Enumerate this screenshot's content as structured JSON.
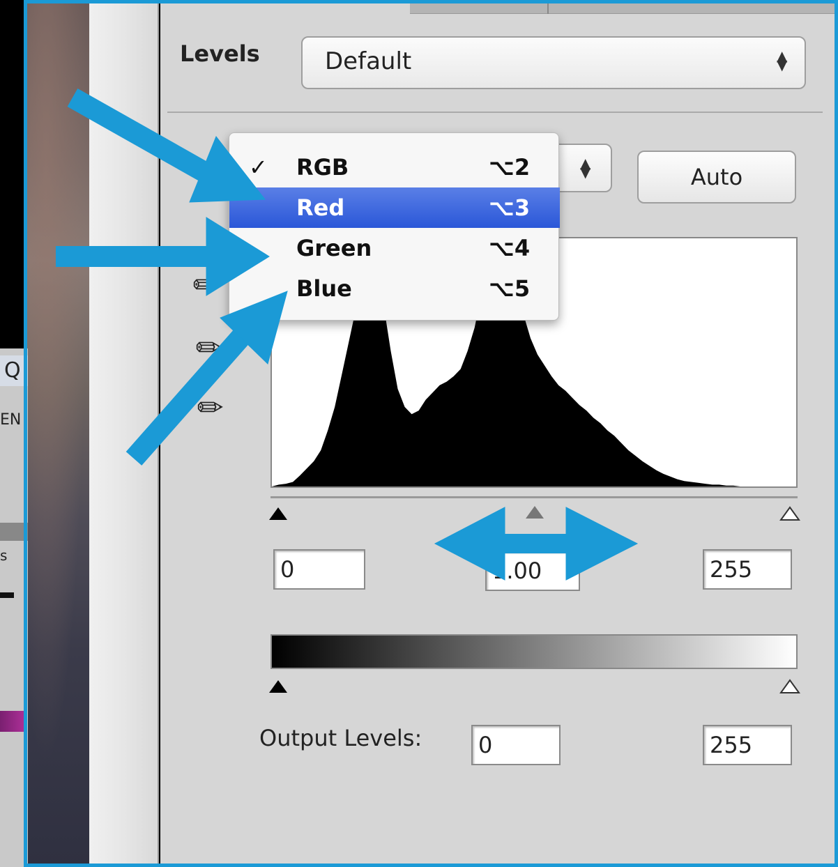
{
  "background_app": {
    "search_glyph": "Q",
    "tab_fragment": "EN",
    "tab_fragment_2": "s"
  },
  "panel": {
    "title": "Levels",
    "preset": {
      "value": "Default"
    },
    "auto_button": "Auto",
    "input_levels": {
      "black": "0",
      "gamma": "1.00",
      "white": "255"
    },
    "output_label": "Output Levels:",
    "output_levels": {
      "black": "0",
      "white": "255"
    }
  },
  "channel_menu": {
    "items": [
      {
        "check": "✓",
        "label": "RGB",
        "shortcut": "⌥2",
        "selected": false
      },
      {
        "check": "",
        "label": "Red",
        "shortcut": "⌥3",
        "selected": true
      },
      {
        "check": "",
        "label": "Green",
        "shortcut": "⌥4",
        "selected": false
      },
      {
        "check": "",
        "label": "Blue",
        "shortcut": "⌥5",
        "selected": false
      }
    ]
  },
  "histogram": {
    "levels": [
      0,
      2,
      3,
      5,
      12,
      20,
      28,
      40,
      62,
      88,
      124,
      160,
      196,
      228,
      250,
      238,
      200,
      150,
      108,
      88,
      80,
      84,
      96,
      104,
      112,
      116,
      122,
      130,
      150,
      176,
      214,
      250,
      262,
      268,
      256,
      226,
      190,
      164,
      146,
      134,
      122,
      112,
      106,
      98,
      90,
      84,
      76,
      70,
      62,
      56,
      48,
      40,
      34,
      28,
      23,
      18,
      14,
      11,
      8,
      6,
      5,
      4,
      3,
      2,
      2,
      1,
      1,
      0,
      0,
      0,
      0,
      0,
      0,
      0,
      0,
      0
    ]
  },
  "colors": {
    "highlight_blue": "#2a57d8",
    "annotation_arrow": "#1b9ad6",
    "panel_gray": "#d6d6d6"
  },
  "icons": [
    "eyedropper-black-icon",
    "eyedropper-gray-icon",
    "eyedropper-white-icon",
    "black-point-slider",
    "gamma-slider",
    "white-point-slider"
  ]
}
